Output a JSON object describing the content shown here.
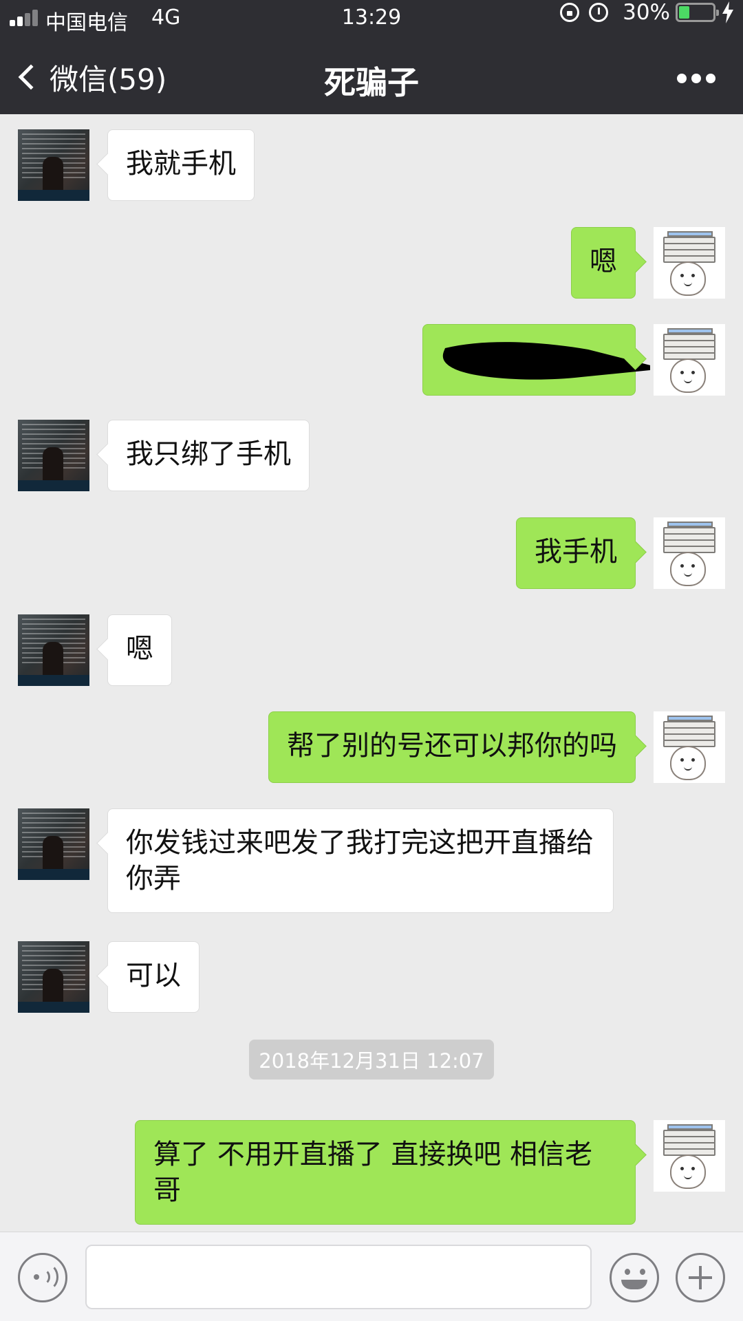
{
  "status_bar": {
    "carrier": "中国电信",
    "network": "4G",
    "time": "13:29",
    "battery_percent": "30%",
    "battery_level": 0.3,
    "signal_bars": 2,
    "signal_total": 4,
    "icons": [
      "signal-icon",
      "orientation-lock-icon",
      "alarm-icon",
      "battery-icon",
      "charging-icon"
    ]
  },
  "nav": {
    "back_label": "微信(59)",
    "title": "死骗子",
    "more_icon": "more-icon"
  },
  "colors": {
    "nav_bg": "#2e2e33",
    "chat_bg": "#ebebeb",
    "sent_bubble": "#9fe657",
    "received_bubble": "#ffffff",
    "timestamp_bg": "#cecece"
  },
  "messages": [
    {
      "sender": "other",
      "text": "我就手机"
    },
    {
      "sender": "me",
      "text": "嗯"
    },
    {
      "sender": "me",
      "text": "",
      "redacted": true
    },
    {
      "sender": "other",
      "text": "我只绑了手机"
    },
    {
      "sender": "me",
      "text": "我手机"
    },
    {
      "sender": "other",
      "text": "嗯"
    },
    {
      "sender": "me",
      "text": "帮了别的号还可以邦你的吗"
    },
    {
      "sender": "other",
      "text": "你发钱过来吧发了我打完这把开直播给你弄"
    },
    {
      "sender": "other",
      "text": "可以"
    },
    {
      "timestamp": "2018年12月31日 12:07"
    },
    {
      "sender": "me",
      "text": "算了 不用开直播了 直接换吧 相信老哥"
    }
  ],
  "input_bar": {
    "value": "",
    "placeholder": "",
    "icons": [
      "voice-icon",
      "emoji-icon",
      "plus-icon"
    ]
  }
}
